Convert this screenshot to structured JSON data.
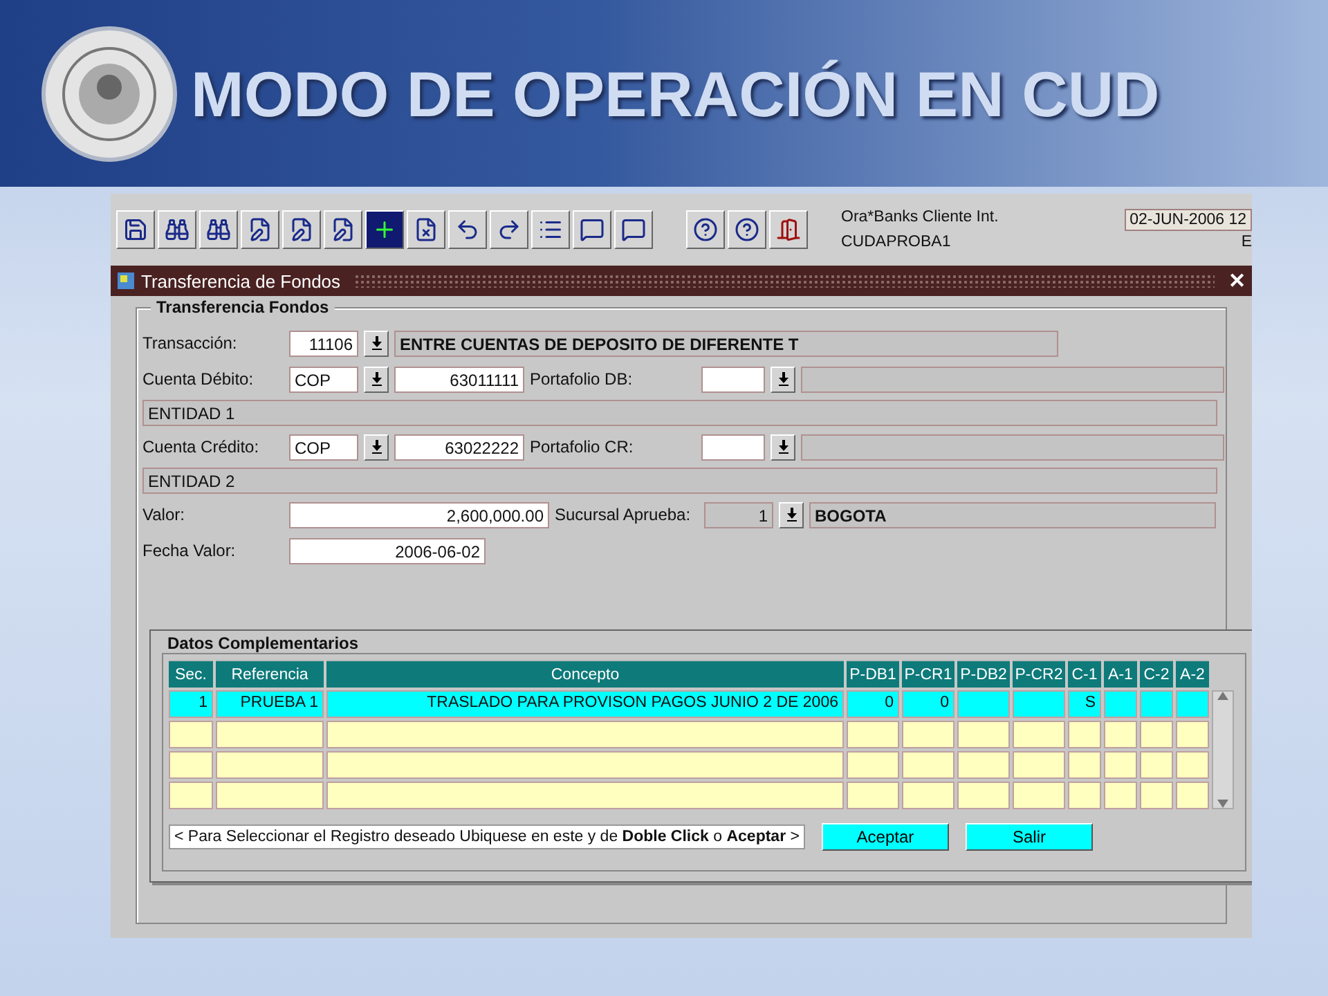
{
  "slide": {
    "title": "MODO DE OPERACIÓN EN CUD"
  },
  "toolbar": {
    "app_name": "Ora*Banks Cliente Int.",
    "user": "CUDAPROBA1",
    "date": "02-JUN-2006 12",
    "status_char": "E"
  },
  "window": {
    "title": "Transferencia de Fondos",
    "close": "✕"
  },
  "form": {
    "section_title": "Transferencia Fondos",
    "transaccion": {
      "label": "Transacción:",
      "code": "11106",
      "description": "ENTRE CUENTAS DE DEPOSITO DE DIFERENTE T"
    },
    "cuenta_debito": {
      "label": "Cuenta Débito:",
      "currency": "COP",
      "account": "63011111",
      "portfolio_label": "Portafolio DB:",
      "entity": "ENTIDAD 1"
    },
    "cuenta_credito": {
      "label": "Cuenta Crédito:",
      "currency": "COP",
      "account": "63022222",
      "portfolio_label": "Portafolio CR:",
      "entity": "ENTIDAD 2"
    },
    "valor": {
      "label": "Valor:",
      "value": "2,600,000.00",
      "branch_label": "Sucursal Aprueba:",
      "branch_code": "1",
      "branch_name": "BOGOTA"
    },
    "fecha_valor": {
      "label": "Fecha Valor:",
      "value": "2006-06-02"
    }
  },
  "dialog": {
    "title": "Datos Complementarios",
    "columns": [
      "Sec.",
      "Referencia",
      "Concepto",
      "P-DB1",
      "P-CR1",
      "P-DB2",
      "P-CR2",
      "C-1",
      "A-1",
      "C-2",
      "A-2"
    ],
    "rows": [
      {
        "selected": true,
        "cells": [
          "1",
          "PRUEBA 1",
          "TRASLADO PARA PROVISON PAGOS JUNIO 2 DE 2006",
          "0",
          "0",
          null,
          null,
          "S",
          null,
          null,
          null
        ]
      },
      {
        "selected": false
      },
      {
        "selected": false
      },
      {
        "selected": false
      }
    ],
    "hint": "< Para Seleccionar  el Registro deseado Ubiquese en este y de **Doble Click** o **Aceptar** >",
    "buttons": [
      "Aceptar",
      "Salir"
    ]
  }
}
